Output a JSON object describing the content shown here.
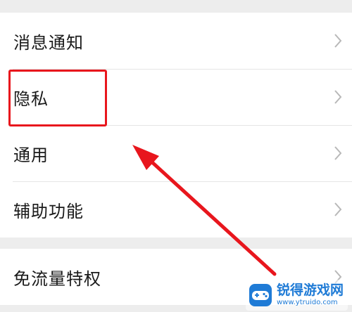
{
  "settings": {
    "items": [
      {
        "label": "消息通知"
      },
      {
        "label": "隐私"
      },
      {
        "label": "通用"
      },
      {
        "label": "辅助功能"
      }
    ],
    "items_2": [
      {
        "label": "免流量特权"
      }
    ]
  },
  "annotation": {
    "highlight_color": "#e8161d",
    "arrow_color": "#e8161d"
  },
  "watermark": {
    "name": "锐得游戏网",
    "url": "www.ytruido.com",
    "color": "#1f7bd6"
  }
}
